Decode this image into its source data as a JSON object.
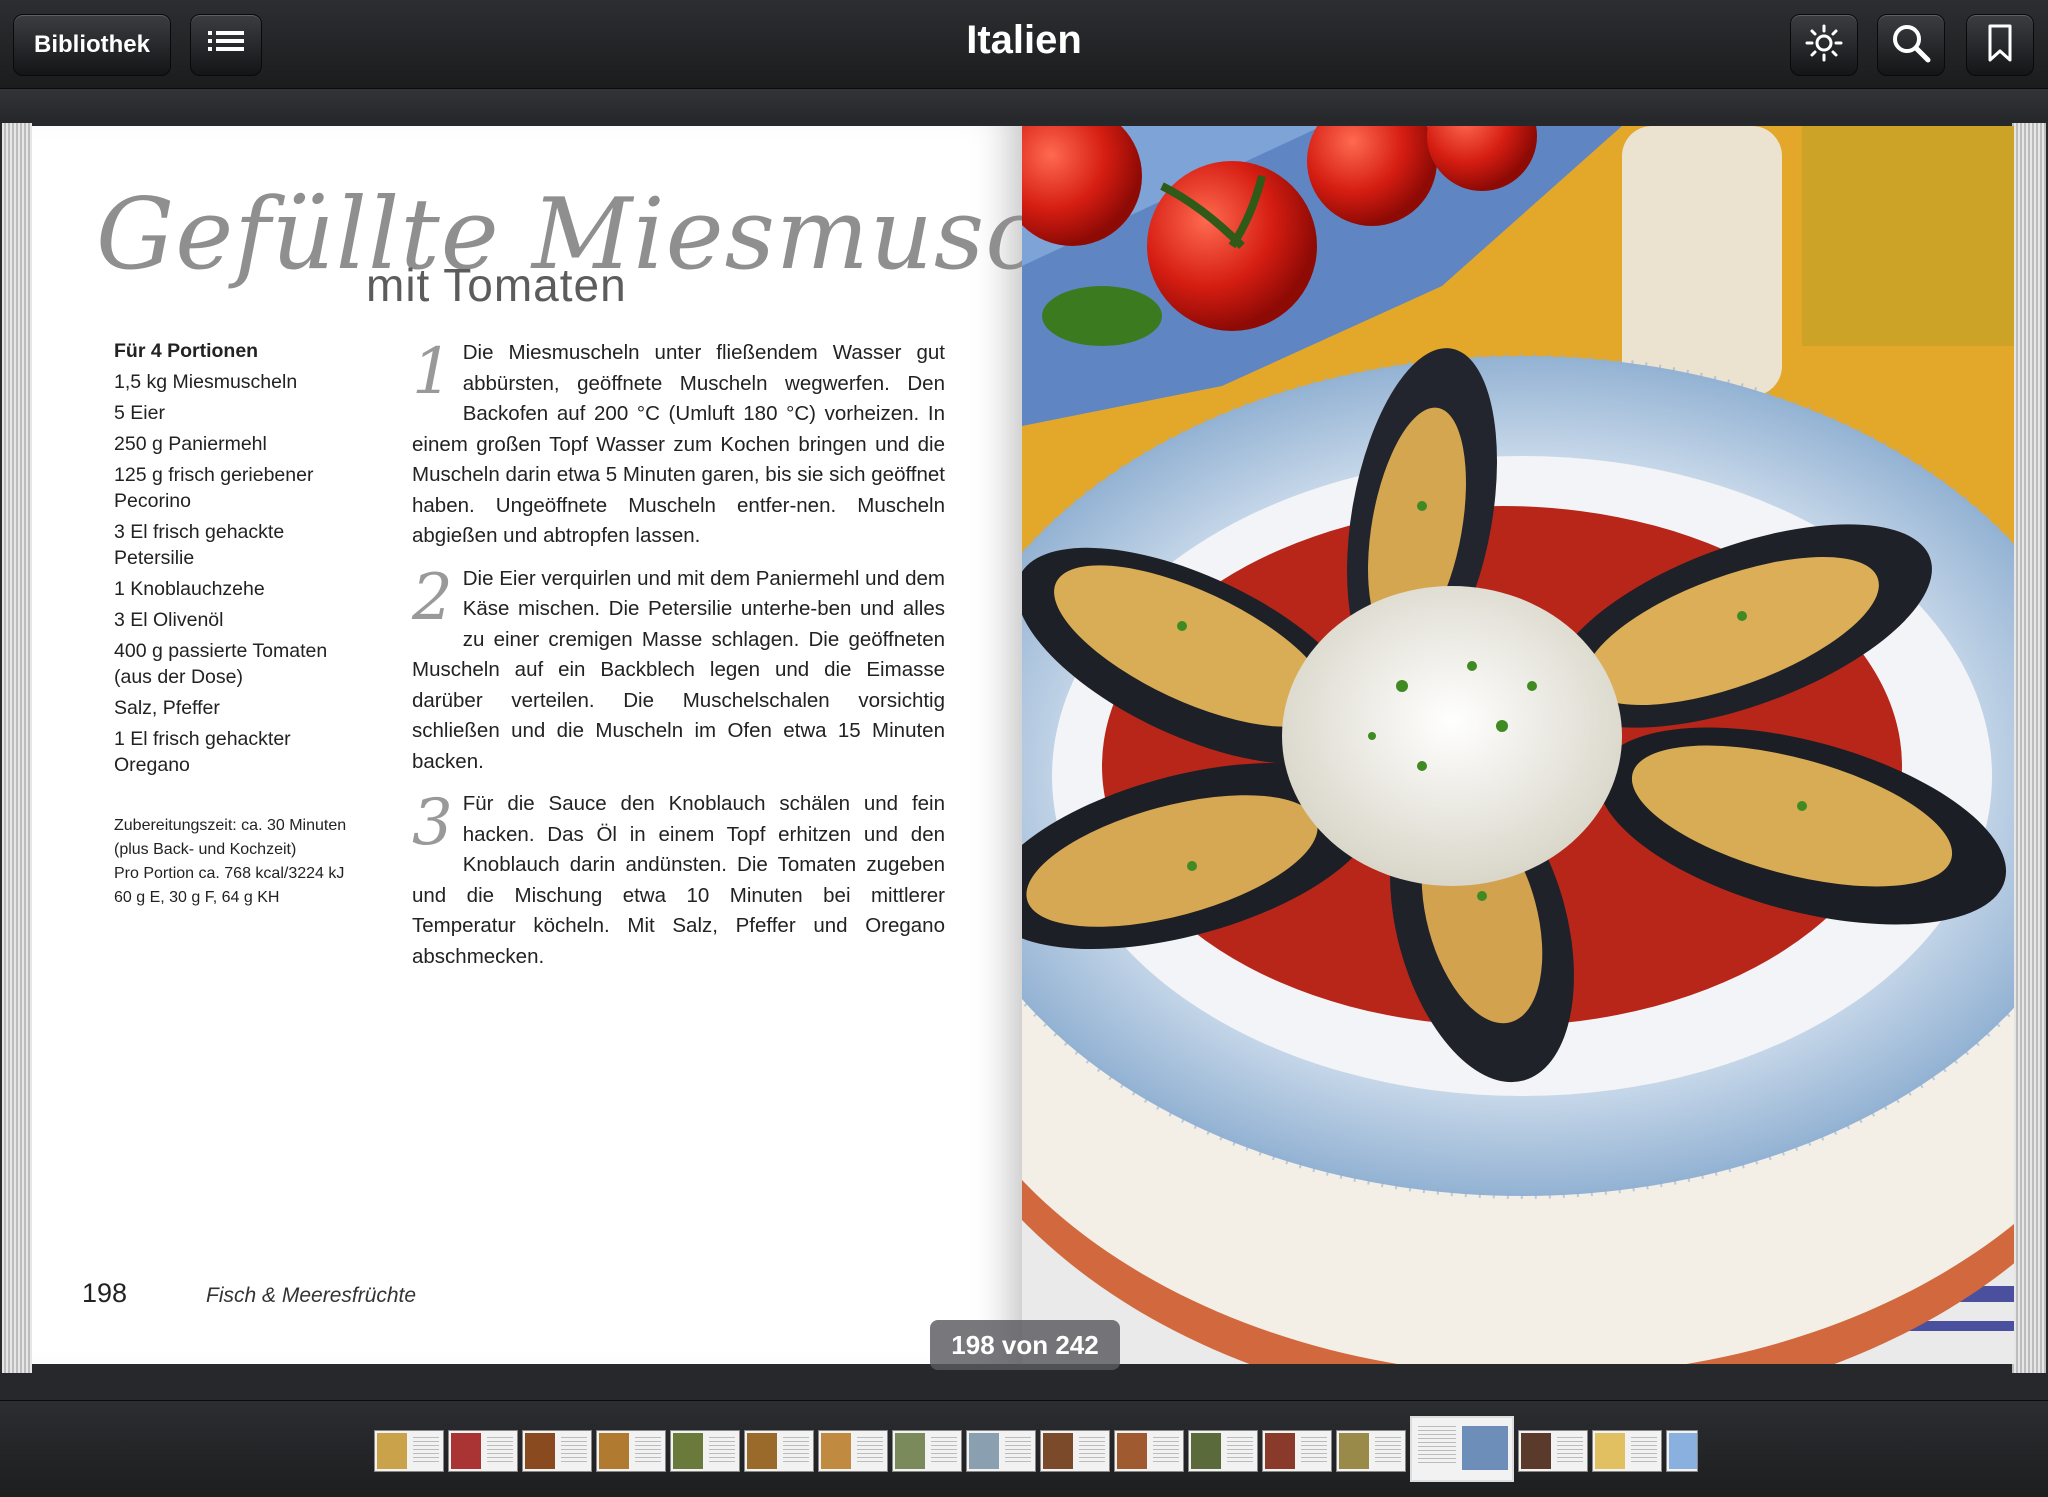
{
  "toolbar": {
    "library_label": "Bibliothek",
    "title": "Italien",
    "icons": [
      "list-icon",
      "brightness-icon",
      "search-icon",
      "bookmark-icon"
    ]
  },
  "recipe": {
    "title": "Gefüllte Miesmuscheln",
    "subtitle": "mit Tomaten",
    "portions": "Für 4 Portionen",
    "ingredients": [
      "1,5 kg Miesmuscheln",
      "5 Eier",
      "250 g Paniermehl",
      "125 g frisch geriebener Pecorino",
      "3 El frisch gehackte Petersilie",
      "1 Knoblauchzehe",
      "3 El Olivenöl",
      "400 g passierte Tomaten (aus der Dose)",
      "Salz, Pfeffer",
      "1 El frisch gehackter Oregano"
    ],
    "notes": [
      "Zubereitungszeit: ca. 30 Minuten",
      "(plus Back- und Kochzeit)",
      "Pro Portion ca. 768 kcal/3224 kJ",
      "60 g E, 30 g F, 64 g KH"
    ],
    "steps": [
      {
        "num": "1",
        "text": "Die Miesmuscheln unter fließendem Wasser gut abbürsten, geöffnete Muscheln wegwerfen. Den Backofen auf 200 °C (Umluft 180 °C) vorheizen. In einem großen Topf Wasser zum Kochen bringen und die Muscheln darin etwa 5 Minuten garen, bis sie sich geöffnet haben. Ungeöffnete Muscheln entfer-nen. Muscheln abgießen und abtropfen lassen."
      },
      {
        "num": "2",
        "text": "Die Eier verquirlen und mit dem Paniermehl und dem Käse mischen. Die Petersilie unterhe-ben und alles zu einer cremigen Masse schlagen. Die geöffneten Muscheln auf ein Backblech legen und die Eimasse darüber verteilen. Die Muschelschalen vorsichtig schließen und die Muscheln im Ofen etwa 15 Minuten backen."
      },
      {
        "num": "3",
        "text": "Für die Sauce den Knoblauch schälen und fein hacken. Das Öl in einem Topf erhitzen und den Knoblauch darin andünsten. Die Tomaten zugeben und die Mischung etwa 10 Minuten bei mittlerer Temperatur köcheln. Mit Salz, Pfeffer und Oregano abschmecken."
      }
    ]
  },
  "footer": {
    "page_number": "198",
    "section": "Fisch & Meeresfrüchte"
  },
  "page_indicator": "198 von 242",
  "colors": {
    "toolbar": "#1f2022",
    "title_gray": "#8f8f8f",
    "plate_blue": "#a9c4de",
    "sauce_red": "#c2291c"
  }
}
